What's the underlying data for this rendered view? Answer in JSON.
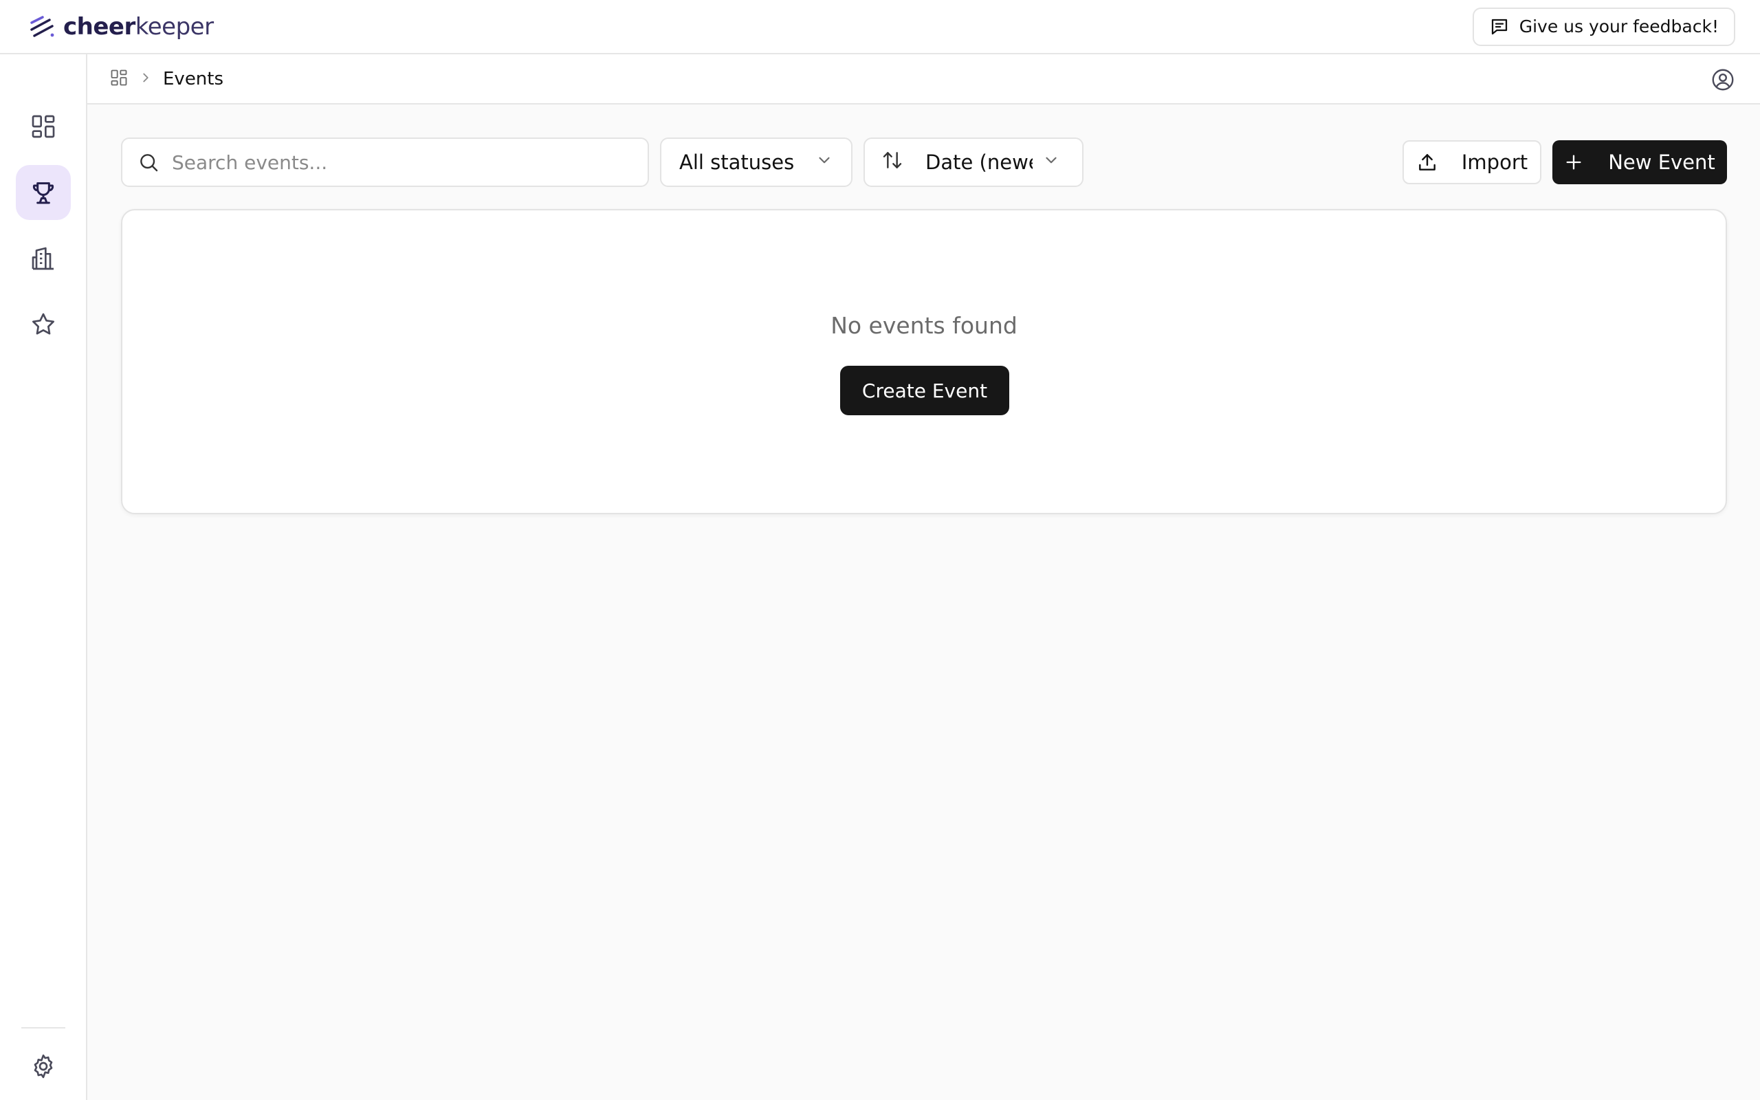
{
  "app": {
    "brand_bold": "cheer",
    "brand_light": "keeper"
  },
  "topbar": {
    "feedback_label": "Give us your feedback!"
  },
  "breadcrumb": {
    "current": "Events"
  },
  "toolbar": {
    "search_placeholder": "Search events...",
    "status_filter": "All statuses",
    "sort_label": "Date (newest)",
    "import_label": "Import",
    "new_event_label": "New Event"
  },
  "empty_state": {
    "message": "No events found",
    "create_label": "Create Event"
  },
  "theme": {
    "accent_bg": "#ece5fb",
    "brand": "#241f4d",
    "dark_button": "#171717"
  },
  "icons": {
    "sidebar": [
      "dashboard-icon",
      "trophy-icon",
      "building-icon",
      "star-icon",
      "settings-icon"
    ]
  }
}
